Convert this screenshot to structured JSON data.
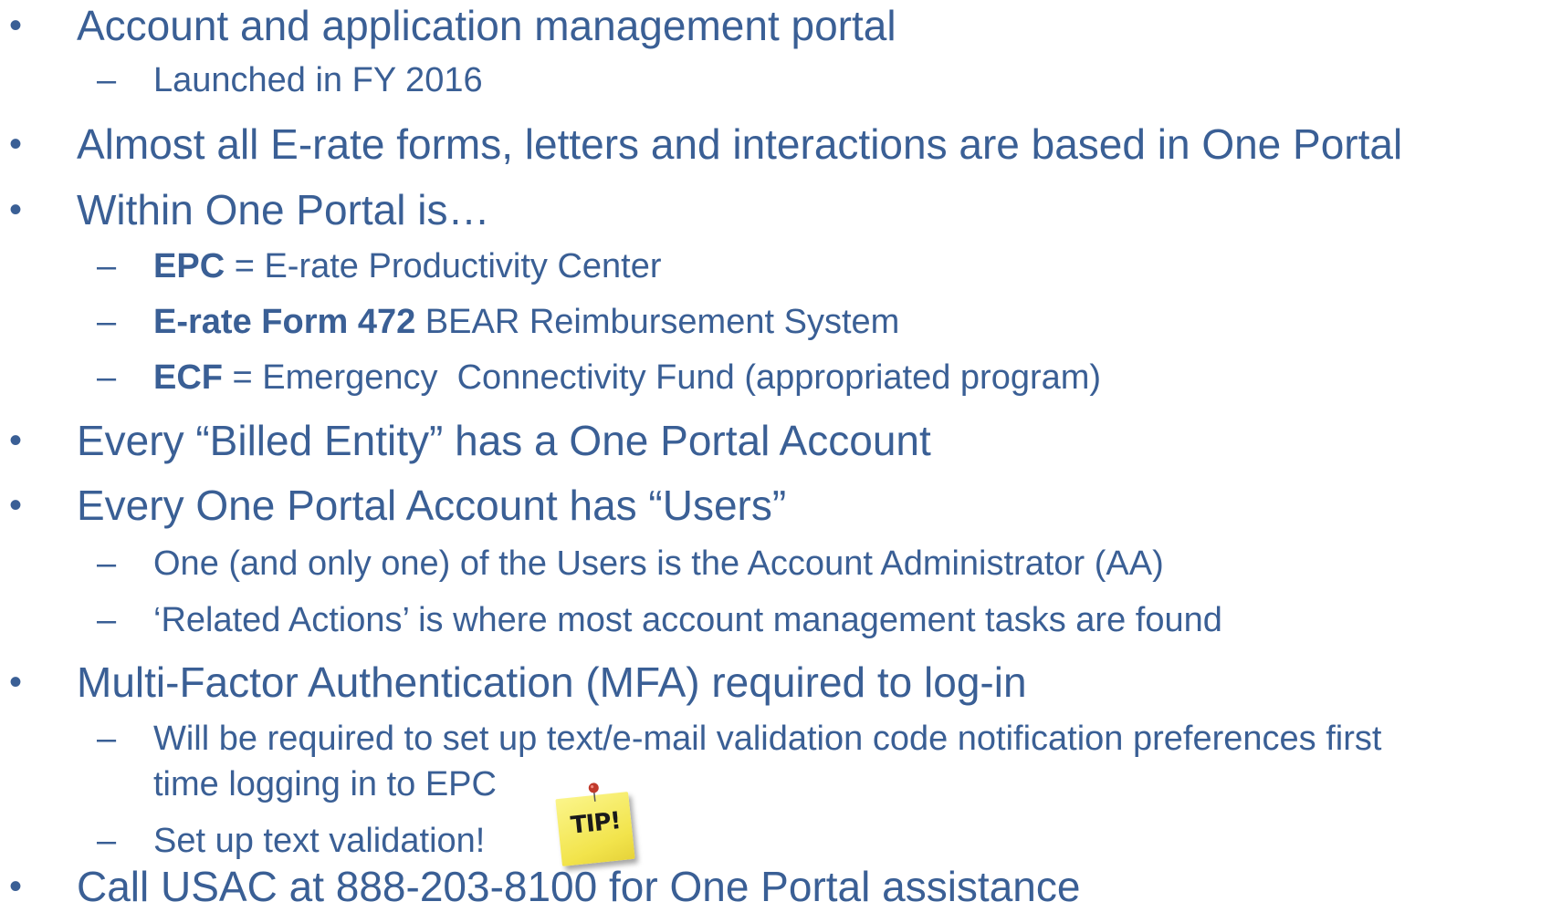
{
  "bullets": [
    {
      "text": "Account and application management portal",
      "sub": [
        "Launched in FY 2016"
      ]
    },
    {
      "text": "Almost all E-rate forms, letters and interactions are based in One Portal"
    },
    {
      "text": "Within One Portal is…",
      "sub_rich": [
        {
          "bold": "EPC",
          "rest": " = E-rate Productivity Center"
        },
        {
          "bold": "E-rate Form 472",
          "rest": " BEAR Reimbursement System"
        },
        {
          "bold": "ECF",
          "rest": " = Emergency  Connectivity Fund (appropriated program)"
        }
      ]
    },
    {
      "text": "Every “Billed Entity” has a One Portal Account"
    },
    {
      "text": "Every One Portal Account has “Users”",
      "sub": [
        "One (and only one) of the Users is the Account Administrator (AA)",
        "‘Related Actions’ is where most account management tasks are found"
      ]
    },
    {
      "text": "Multi-Factor Authentication (MFA) required to log-in",
      "sub_multiline": {
        "line1": "Will be required to set up text/e-mail validation code notification preferences first",
        "line2": "time logging in to EPC"
      },
      "sub_last": "Set up text validation!"
    },
    {
      "text": "Call USAC at 888-203-8100 for One Portal assistance"
    }
  ],
  "bullet_glyph": "•",
  "dash_glyph": "–",
  "tip_note": {
    "label": "TIP!",
    "icon": "sticky-note-icon"
  },
  "colors": {
    "text": "#3A5F95",
    "note": "#F2E44C",
    "pin": "#C0392B"
  }
}
